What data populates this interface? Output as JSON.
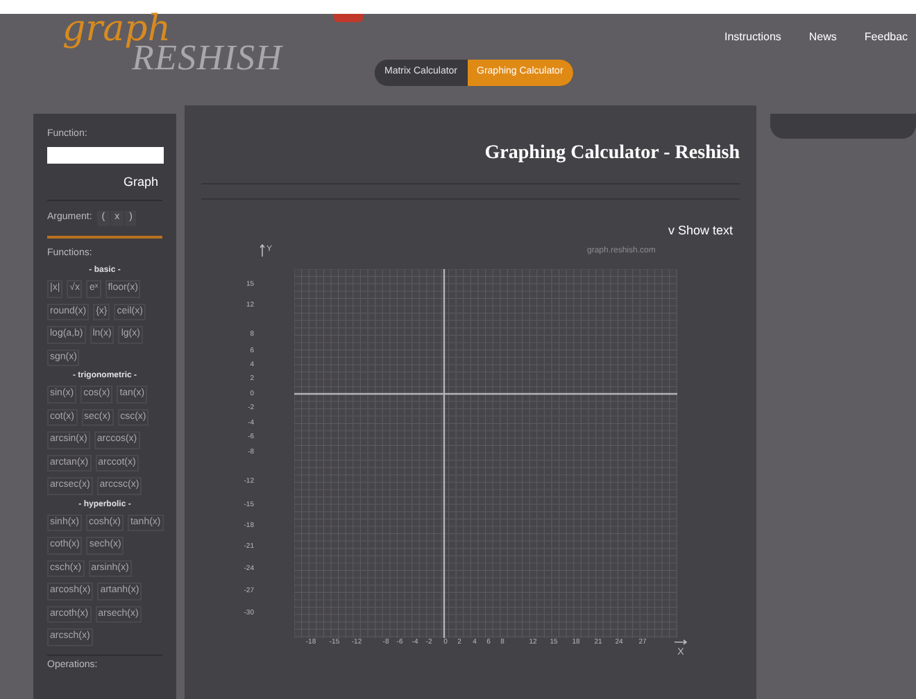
{
  "logo": {
    "top": "graph",
    "bottom": "RESHISH"
  },
  "nav": [
    "Instructions",
    "News",
    "Feedbac"
  ],
  "calculator_tabs": [
    {
      "label": "Matrix Calculator",
      "selected": false
    },
    {
      "label": "Graphing Calculator",
      "selected": true
    }
  ],
  "sidebar": {
    "function_label": "Function:",
    "graph_button": "Graph",
    "argument_label": "Argument:",
    "argument_keys": [
      "(",
      "x",
      ")"
    ],
    "functions_label": "Functions:",
    "groups": [
      {
        "title": "- basic -",
        "buttons": [
          "|x|",
          "√x",
          "eˣ",
          "floor(x)",
          "round(x)",
          "{x}",
          "ceil(x)",
          "log(a,b)",
          "ln(x)",
          "lg(x)",
          "sgn(x)"
        ]
      },
      {
        "title": "- trigonometric -",
        "buttons": [
          "sin(x)",
          "cos(x)",
          "tan(x)",
          "cot(x)",
          "sec(x)",
          "csc(x)",
          "arcsin(x)",
          "arccos(x)",
          "arctan(x)",
          "arccot(x)",
          "arcsec(x)",
          "arccsc(x)"
        ]
      },
      {
        "title": "- hyperbolic -",
        "buttons": [
          "sinh(x)",
          "cosh(x)",
          "tanh(x)",
          "coth(x)",
          "sech(x)",
          "csch(x)",
          "arsinh(x)",
          "arcosh(x)",
          "artanh(x)",
          "arcoth(x)",
          "arsech(x)",
          "arcsch(x)"
        ]
      }
    ],
    "operations_label": "Operations:"
  },
  "main": {
    "title": "Graphing Calculator - Reshish",
    "show_text": "v Show text",
    "graph": {
      "y_axis_label": "Y",
      "x_axis_label": "X",
      "watermark": "graph.reshish.com",
      "y_ticks": [
        "15",
        "12",
        "8",
        "6",
        "4",
        "2",
        "0",
        "-2",
        "-4",
        "-6",
        "-8",
        "-12",
        "-15",
        "-18",
        "-21",
        "-24",
        "-27",
        "-30"
      ],
      "x_ticks": [
        "-18",
        "-15",
        "-12",
        "-8",
        "-6",
        "-4",
        "-2",
        "0",
        "2",
        "4",
        "6",
        "8",
        "12",
        "15",
        "18",
        "21",
        "24",
        "27"
      ]
    }
  }
}
